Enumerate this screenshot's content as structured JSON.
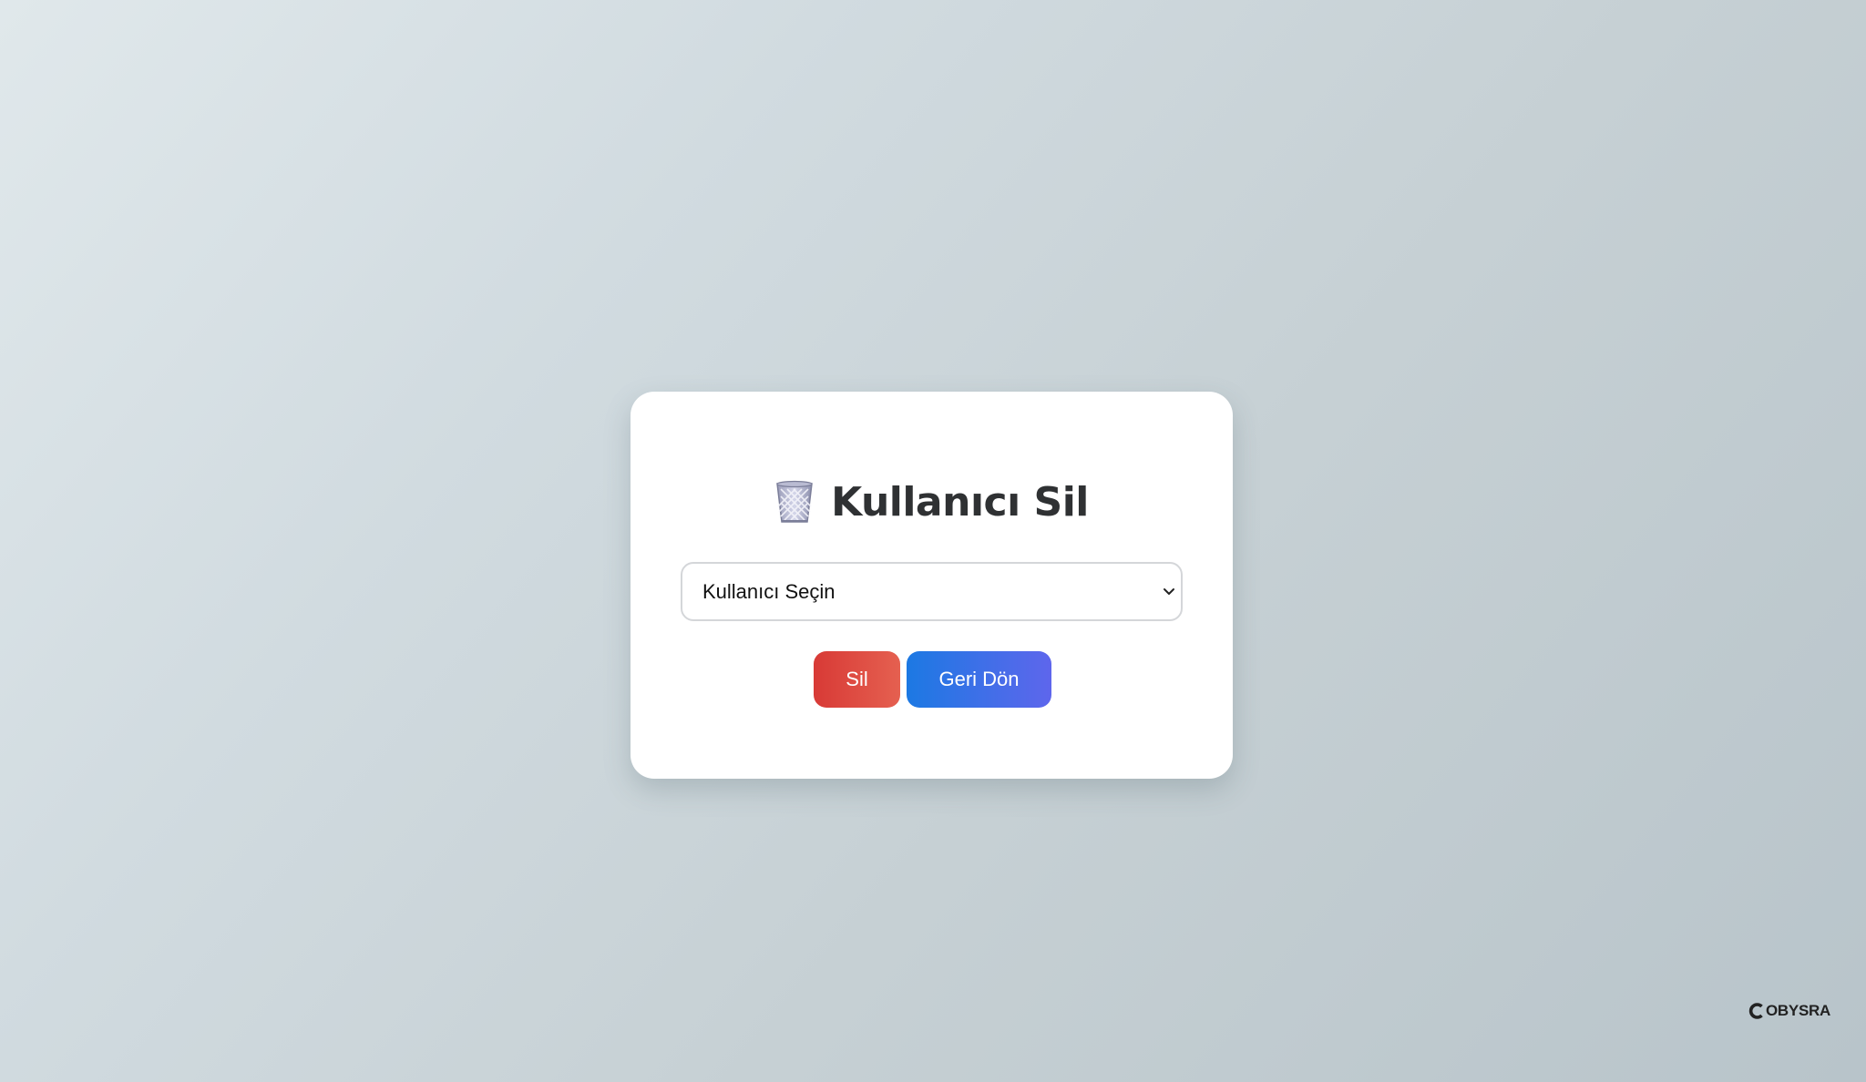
{
  "page": {
    "background_start": "#e0e8eb",
    "background_end": "#b8c4ca"
  },
  "card": {
    "title_icon": "wastebasket-icon",
    "title": "Kullanıcı Sil",
    "user_select": {
      "selected_value": "Kullanıcı Seçin"
    },
    "buttons": {
      "delete_label": "Sil",
      "back_label": "Geri Dön"
    },
    "colors": {
      "delete": "#d83a36",
      "back": "#1c79e3"
    }
  },
  "watermark": {
    "logo_icon": "cobysra-logo-icon",
    "text": "OBYSRA"
  }
}
